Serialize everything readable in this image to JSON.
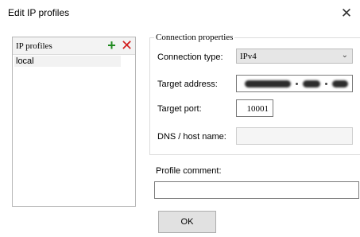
{
  "window": {
    "title": "Edit IP profiles",
    "close_symbol": "✕"
  },
  "profiles": {
    "header_label": "IP profiles",
    "add_symbol": "+",
    "delete_symbol": "✕",
    "items": [
      "local"
    ]
  },
  "connection": {
    "legend": "Connection properties",
    "type_label": "Connection type:",
    "type_value": "IPv4",
    "address_label": "Target address:",
    "port_label": "Target port:",
    "port_value": "10001",
    "dns_label": "DNS / host name:",
    "dns_value": ""
  },
  "comment": {
    "label": "Profile comment:",
    "value": ""
  },
  "buttons": {
    "ok": "OK"
  },
  "icons": {
    "close": "close-icon",
    "add": "plus-icon",
    "delete": "x-icon",
    "dropdown": "chevron-down-icon"
  },
  "colors": {
    "add": "#1f8a1f",
    "delete": "#d21d1d"
  }
}
